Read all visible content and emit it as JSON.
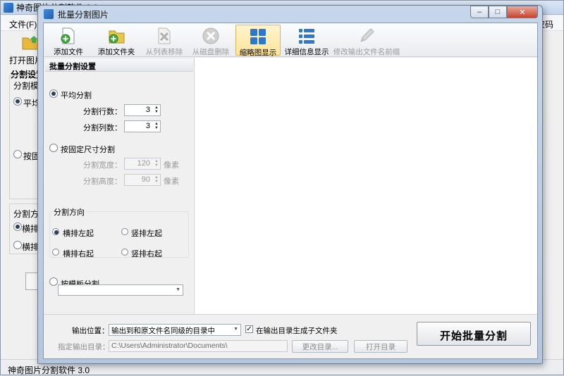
{
  "main_window": {
    "title": "神奇图片分割软件 3.0",
    "menu_file": "文件(F)",
    "menu_right": "权码",
    "open_image": "打开图片",
    "split_settings": "分割设置",
    "split_mode": "分割模式",
    "avg": "平均分",
    "fixed": "按固",
    "direction": "分割方向",
    "h_left": "横排左",
    "h_right": "横排右",
    "status": "神奇图片分割软件 3.0"
  },
  "dialog": {
    "title": "批量分割图片",
    "window_buttons": {
      "min": "–",
      "max": "□",
      "close": "✕"
    }
  },
  "toolbar": [
    {
      "label": "添加文件",
      "icon": "add-file-icon",
      "enabled": true
    },
    {
      "label": "添加文件夹",
      "icon": "add-folder-icon",
      "enabled": true
    },
    {
      "label": "从列表移除",
      "icon": "remove-from-list-icon",
      "enabled": false
    },
    {
      "label": "从磁盘删除",
      "icon": "delete-from-disk-icon",
      "enabled": false
    },
    {
      "label": "缩略图显示",
      "icon": "thumbnail-view-icon",
      "enabled": true,
      "active": true
    },
    {
      "label": "详细信息显示",
      "icon": "detail-view-icon",
      "enabled": true
    },
    {
      "label": "修改输出文件名前缀",
      "icon": "edit-prefix-icon",
      "enabled": false
    }
  ],
  "left_panel": {
    "header": "批量分割设置",
    "avg_split": "平均分割",
    "rows_label": "分割行数：",
    "rows_value": "3",
    "cols_label": "分割列数：",
    "cols_value": "3",
    "fixed_split": "按固定尺寸分割",
    "width_label": "分割宽度：",
    "width_value": "120",
    "height_label": "分割高度：",
    "height_value": "90",
    "unit": "像素",
    "direction_label": "分割方向",
    "dir_h_left": "横排左起",
    "dir_v_left": "竖排左起",
    "dir_h_right": "横排右起",
    "dir_v_right": "竖排右起",
    "template_split": "按模板分割",
    "template_value": ""
  },
  "bottom": {
    "output_location_label": "输出位置：",
    "output_location_value": "输出到和原文件名同级的目录中",
    "subfolder_label": "在输出目录生成子文件夹",
    "subfolder_checked": true,
    "output_dir_label": "指定输出目录：",
    "output_dir_value": "C:\\Users\\Administrator\\Documents\\",
    "change_dir": "更改目录...",
    "open_dir": "打开目录",
    "start": "开始批量分割"
  }
}
